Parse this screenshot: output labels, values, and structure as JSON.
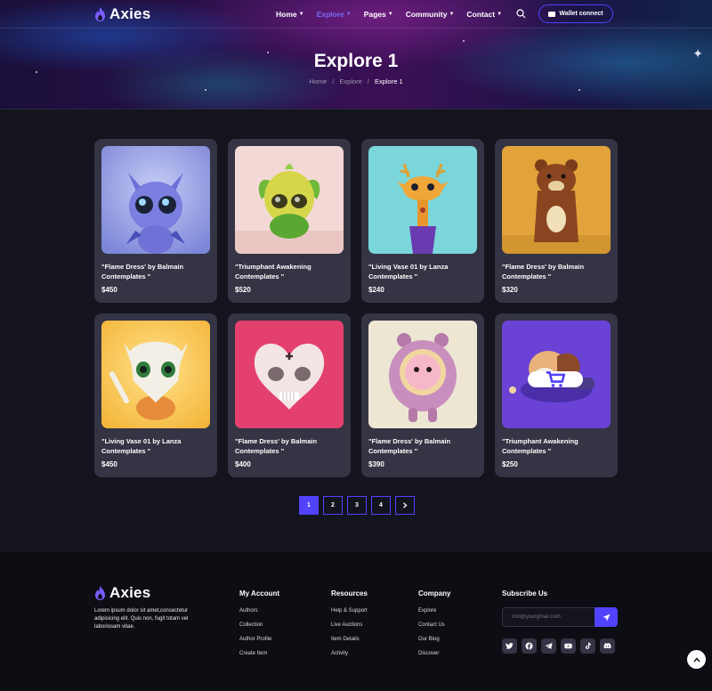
{
  "brand": {
    "name": "Axies"
  },
  "nav": {
    "items": [
      {
        "label": "Home",
        "active": false
      },
      {
        "label": "Explore",
        "active": true
      },
      {
        "label": "Pages",
        "active": false
      },
      {
        "label": "Community",
        "active": false
      },
      {
        "label": "Contact",
        "active": false
      }
    ],
    "wallet_label": "Wallet connect"
  },
  "hero": {
    "title": "Explore 1",
    "breadcrumb": [
      "Home",
      "Explore",
      "Explore 1"
    ]
  },
  "cards": [
    {
      "title": "\"Flame Dress' by Balmain Contemplates \"",
      "price": "$450"
    },
    {
      "title": "\"Triumphant Awakening Contemplates \"",
      "price": "$520"
    },
    {
      "title": "\"Living Vase 01 by Lanza Contemplates \"",
      "price": "$240"
    },
    {
      "title": "\"Flame Dress' by Balmain Contemplates \"",
      "price": "$320"
    },
    {
      "title": "\"Living Vase 01 by Lanza Contemplates \"",
      "price": "$450"
    },
    {
      "title": "\"Flame Dress' by Balmain Contemplates \"",
      "price": "$400"
    },
    {
      "title": "\"Flame Dress' by Balmain Contemplates \"",
      "price": "$390"
    },
    {
      "title": "\"Triumphant Awakening Contemplates \"",
      "price": "$250"
    }
  ],
  "pagination": {
    "pages": [
      "1",
      "2",
      "3",
      "4"
    ],
    "current": "1",
    "next_icon": "chevron-right-icon"
  },
  "footer": {
    "description": "Lorem ipsum dolor sit amet,consectetur adipisicing elit. Quis non, fugit totam vel laboriosam vitae.",
    "my_account": {
      "title": "My Account",
      "links": [
        "Authors",
        "Collection",
        "Author Profile",
        "Create Item"
      ]
    },
    "resources": {
      "title": "Resources",
      "links": [
        "Help & Support",
        "Live Auctions",
        "Item Details",
        "Activity"
      ]
    },
    "company": {
      "title": "Company",
      "links": [
        "Explore",
        "Contact Us",
        "Our Blog",
        "Discover"
      ]
    },
    "subscribe": {
      "title": "Subscribe Us",
      "placeholder": "info@yourgmail.com"
    },
    "socials": [
      "twitter-icon",
      "facebook-icon",
      "telegram-icon",
      "youtube-icon",
      "tiktok-icon",
      "discord-icon"
    ]
  },
  "colors": {
    "accent": "#5142fc",
    "card": "#343444",
    "background": "#14141f",
    "footer": "#0d0d14"
  }
}
